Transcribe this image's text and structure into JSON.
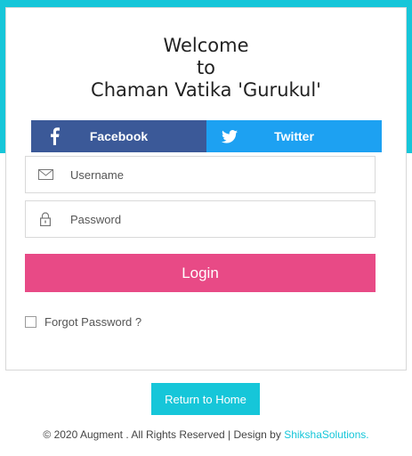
{
  "welcome": {
    "line1": "Welcome",
    "line2": "to",
    "line3": "Chaman Vatika 'Gurukul'"
  },
  "social": {
    "facebook_label": "Facebook",
    "twitter_label": "Twitter",
    "facebook_icon": "facebook-icon",
    "twitter_icon": "twitter-icon"
  },
  "form": {
    "username_placeholder": "Username",
    "username_value": "",
    "password_placeholder": "Password",
    "password_value": "",
    "login_label": "Login",
    "forgot_label": "Forgot Password ?",
    "forgot_checked": false
  },
  "home_button_label": "Return to Home",
  "footer": {
    "text": "© 2020 Augment . All Rights Reserved | Design by ",
    "link": "ShikshaSolutions."
  },
  "colors": {
    "accent_teal": "#16c6d9",
    "facebook_blue": "#3b5998",
    "twitter_blue": "#1da1f2",
    "login_pink": "#e84a86"
  }
}
